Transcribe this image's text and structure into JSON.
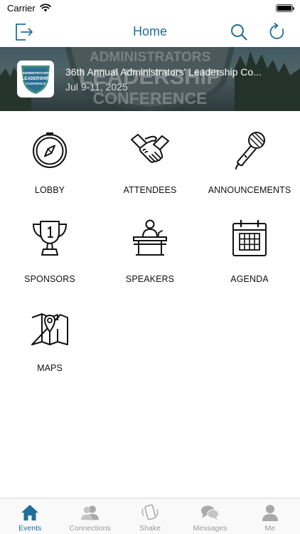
{
  "status_bar": {
    "carrier": "Carrier"
  },
  "nav": {
    "title": "Home"
  },
  "banner": {
    "title": "36th Annual Administrators' Leadership Co...",
    "date": "Jul 9-11, 2025",
    "background_text": [
      "ADMINISTRATORS",
      "LEADERSHIP",
      "CONFERENCE"
    ],
    "logo_text": [
      "ADMINISTRATORS",
      "LEADERSHIP",
      "CONFERENCE"
    ]
  },
  "tiles": [
    {
      "label": "LOBBY",
      "icon": "compass-icon"
    },
    {
      "label": "ATTENDEES",
      "icon": "handshake-icon"
    },
    {
      "label": "ANNOUNCEMENTS",
      "icon": "microphone-icon"
    },
    {
      "label": "SPONSORS",
      "icon": "trophy-icon"
    },
    {
      "label": "SPEAKERS",
      "icon": "podium-icon"
    },
    {
      "label": "AGENDA",
      "icon": "calendar-icon"
    },
    {
      "label": "MAPS",
      "icon": "map-icon"
    }
  ],
  "tabs": [
    {
      "label": "Events",
      "icon": "home-icon",
      "active": true
    },
    {
      "label": "Connections",
      "icon": "people-icon",
      "active": false
    },
    {
      "label": "Shake",
      "icon": "shake-phone-icon",
      "active": false
    },
    {
      "label": "Messages",
      "icon": "chat-bubbles-icon",
      "active": false
    },
    {
      "label": "Me",
      "icon": "person-icon",
      "active": false
    }
  ],
  "colors": {
    "accent": "#1f6f9b",
    "inactive_tab": "#999999",
    "text": "#111111"
  }
}
